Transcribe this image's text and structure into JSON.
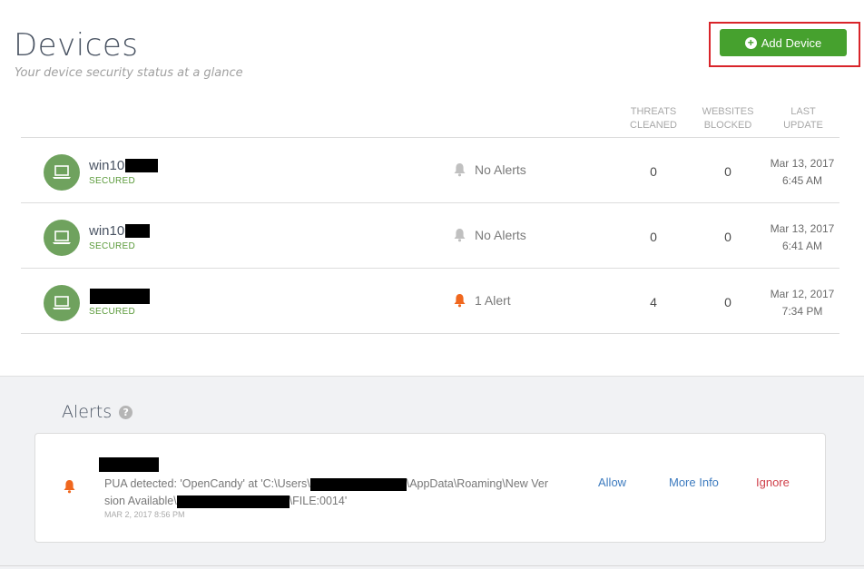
{
  "header": {
    "title": "Devices",
    "subtitle": "Your device security status at a glance",
    "add_device_label": "Add Device"
  },
  "columns": {
    "threats": [
      "THREATS",
      "CLEANED"
    ],
    "websites": [
      "WEBSITES",
      "BLOCKED"
    ],
    "update": [
      "LAST",
      "UPDATE"
    ]
  },
  "devices": [
    {
      "name": "win10",
      "status": "SECURED",
      "alerts": "No Alerts",
      "has_alert": false,
      "threats": "0",
      "websites": "0",
      "date": "Mar 13, 2017",
      "time": "6:45 AM"
    },
    {
      "name": "win10",
      "status": "SECURED",
      "alerts": "No Alerts",
      "has_alert": false,
      "threats": "0",
      "websites": "0",
      "date": "Mar 13, 2017",
      "time": "6:41 AM"
    },
    {
      "name": "",
      "status": "SECURED",
      "alerts": "1 Alert",
      "has_alert": true,
      "threats": "4",
      "websites": "0",
      "date": "Mar 12, 2017",
      "time": "7:34 PM"
    }
  ],
  "alerts_panel": {
    "heading": "Alerts",
    "help_icon": "?",
    "items": [
      {
        "message_part1": "PUA detected: 'OpenCandy' at 'C:\\Users\\",
        "message_part2": "\\AppData\\Roaming\\New Ver",
        "message_part3": "sion Available\\",
        "message_part4": "\\FILE:0014'",
        "timestamp": "MAR 2, 2017 8:56 PM",
        "allow_label": "Allow",
        "more_info_label": "More Info",
        "ignore_label": "Ignore"
      }
    ]
  },
  "colors": {
    "accent_green": "#46a12e",
    "secured_green": "#5a9a3a",
    "avatar_green": "#6fa25e",
    "alert_orange": "#f0671e",
    "muted_bell": "#c0c0c0",
    "link_blue": "#3d7bbf",
    "ignore_red": "#d0414b",
    "highlight_red": "#d9242a"
  },
  "icons": {
    "laptop": "laptop-icon",
    "bell": "bell-icon",
    "plus": "plus-circle-icon",
    "help": "help-icon"
  }
}
